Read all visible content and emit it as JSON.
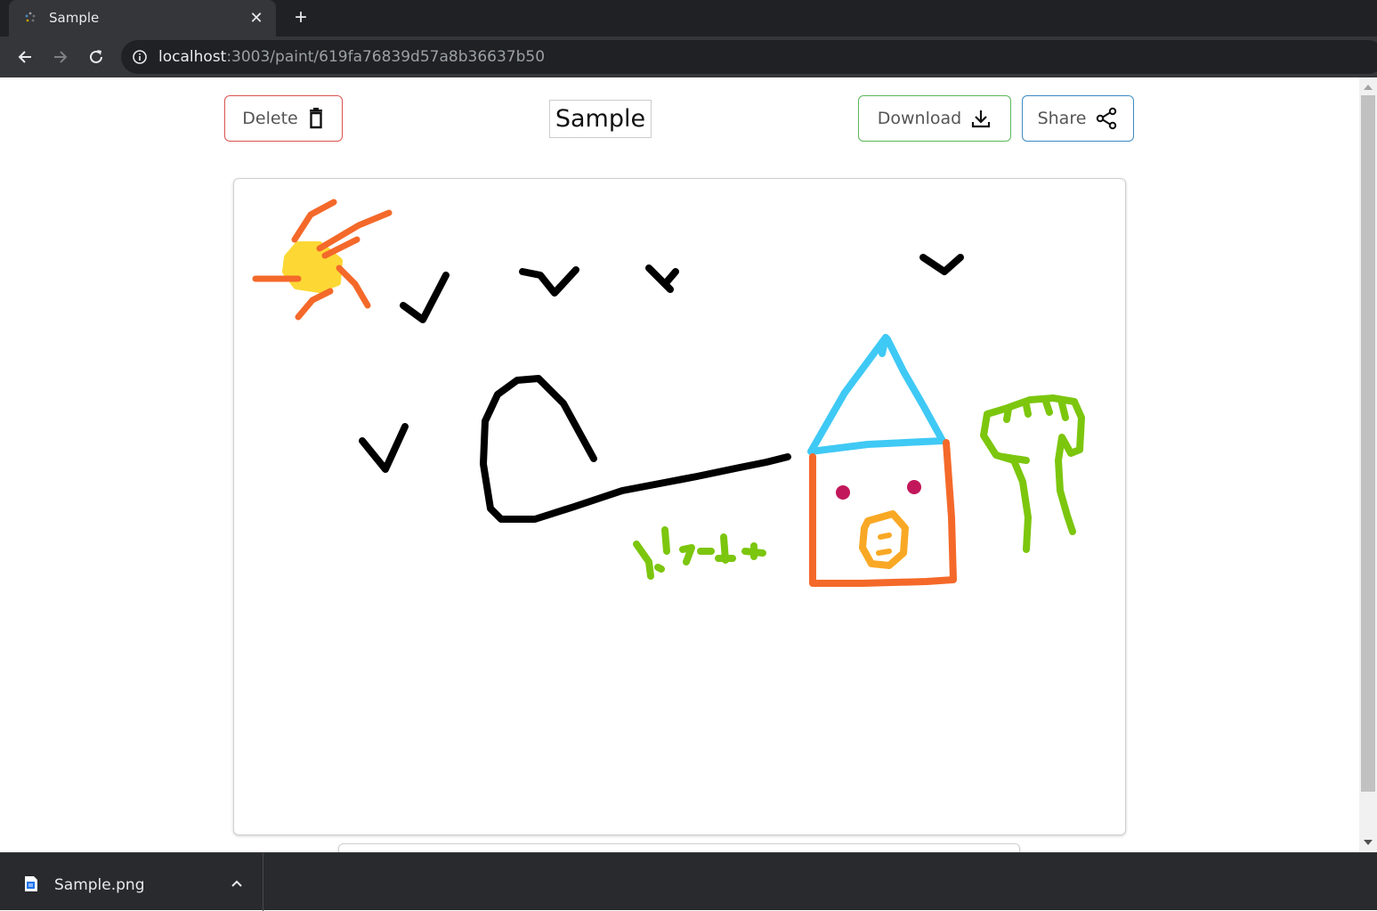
{
  "browser": {
    "tab_title": "Sample",
    "url_host": "localhost",
    "url_rest": ":3003/paint/619fa76839d57a8b36637b50"
  },
  "page": {
    "delete_label": "Delete",
    "drawing_title": "Sample",
    "download_label": "Download",
    "share_label": "Share"
  },
  "colors": {
    "delete_border": "#d9534f",
    "download_border": "#5cb85c",
    "share_border": "#3b8bc2",
    "sun_yellow": "#fdd835",
    "ray_orange": "#f4692a",
    "bird_black": "#000000",
    "roof_blue": "#3fc9f5",
    "wall_orange": "#f4692a",
    "window_crimson": "#c2185b",
    "door_amber": "#f9a825",
    "tree_green": "#7cc60e"
  },
  "icons": {
    "delete": "trash-icon",
    "download": "download-icon",
    "share": "share-icon",
    "reload": "reload-icon",
    "back": "arrow-left-icon",
    "forward": "arrow-right-icon",
    "info": "info-icon",
    "file": "file-icon"
  },
  "downloads": {
    "file_name": "Sample.png"
  }
}
